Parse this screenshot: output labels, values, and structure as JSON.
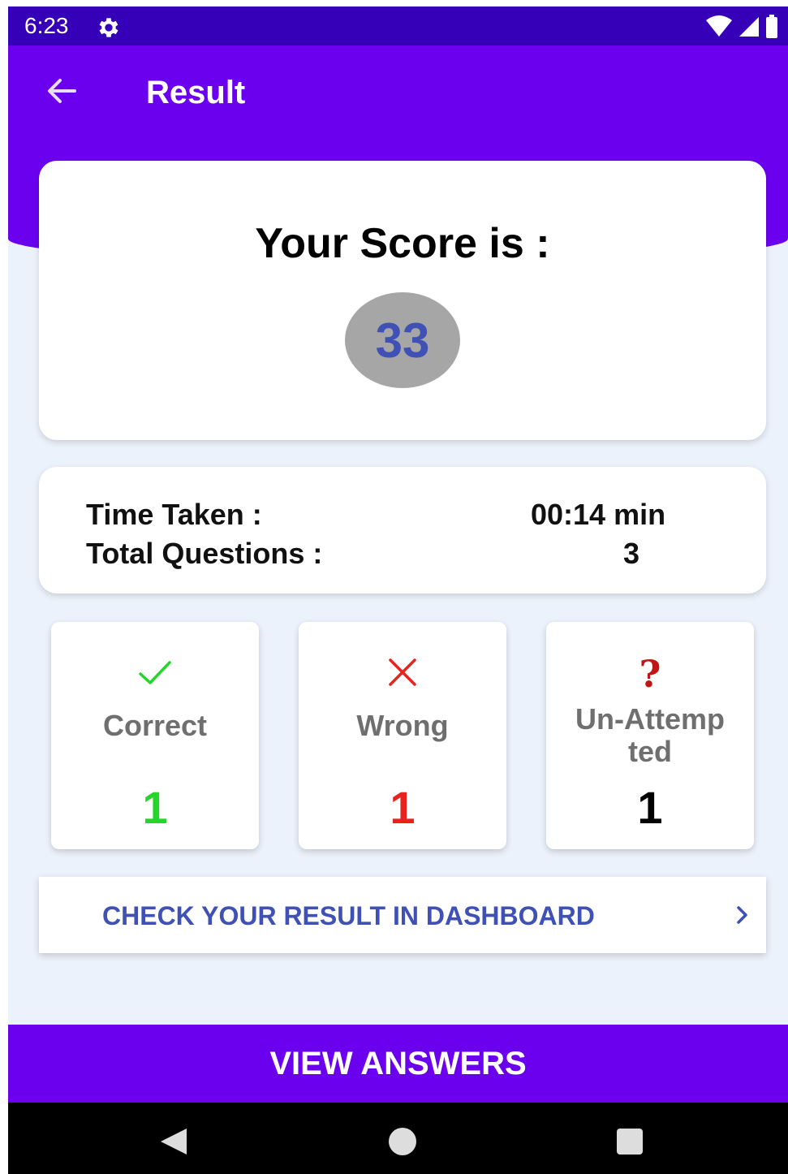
{
  "status_bar": {
    "time": "6:23"
  },
  "header": {
    "title": "Result"
  },
  "score": {
    "label": "Your Score is :",
    "value": "33"
  },
  "info": {
    "time_taken_label": "Time Taken :",
    "time_taken_value": "00:14 min",
    "total_questions_label": "Total Questions :",
    "total_questions_value": "3"
  },
  "stats": {
    "correct": {
      "label": "Correct",
      "value": "1",
      "color": "#25d52a",
      "icon": "check-icon"
    },
    "wrong": {
      "label": "Wrong",
      "value": "1",
      "color": "#e8231e",
      "icon": "close-icon"
    },
    "unattempted": {
      "label_line1": "Un-Attemp",
      "label_line2": "ted",
      "value": "1",
      "color": "#000000",
      "icon": "question-icon"
    }
  },
  "dashboard_link": {
    "label": "CHECK YOUR RESULT IN DASHBOARD"
  },
  "view_answers": {
    "label": "VIEW ANSWERS"
  },
  "colors": {
    "primary": "#6b00ef",
    "status_bar": "#3500b8",
    "accent_text": "#3f51b5",
    "background": "#ecf2fb"
  }
}
